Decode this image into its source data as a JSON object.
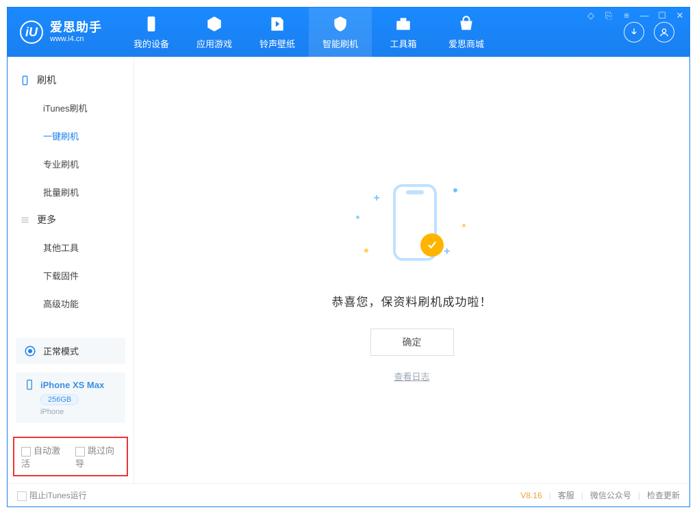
{
  "app": {
    "name_cn": "爱思助手",
    "name_en": "www.i4.cn"
  },
  "nav": {
    "items": [
      {
        "label": "我的设备"
      },
      {
        "label": "应用游戏"
      },
      {
        "label": "铃声壁纸"
      },
      {
        "label": "智能刷机"
      },
      {
        "label": "工具箱"
      },
      {
        "label": "爱思商城"
      }
    ],
    "active_index": 3
  },
  "sidebar": {
    "sections": [
      {
        "title": "刷机",
        "items": [
          "iTunes刷机",
          "一键刷机",
          "专业刷机",
          "批量刷机"
        ],
        "active_index": 1
      },
      {
        "title": "更多",
        "items": [
          "其他工具",
          "下载固件",
          "高级功能"
        ],
        "active_index": -1
      }
    ],
    "mode": "正常模式",
    "device": {
      "name": "iPhone XS Max",
      "capacity": "256GB",
      "type": "iPhone"
    },
    "options": {
      "auto_activate": "自动激活",
      "skip_guide": "跳过向导"
    }
  },
  "main": {
    "message": "恭喜您，保资料刷机成功啦！",
    "ok": "确定",
    "view_log": "查看日志"
  },
  "footer": {
    "block_itunes": "阻止iTunes运行",
    "version": "V8.16",
    "links": [
      "客服",
      "微信公众号",
      "检查更新"
    ]
  }
}
